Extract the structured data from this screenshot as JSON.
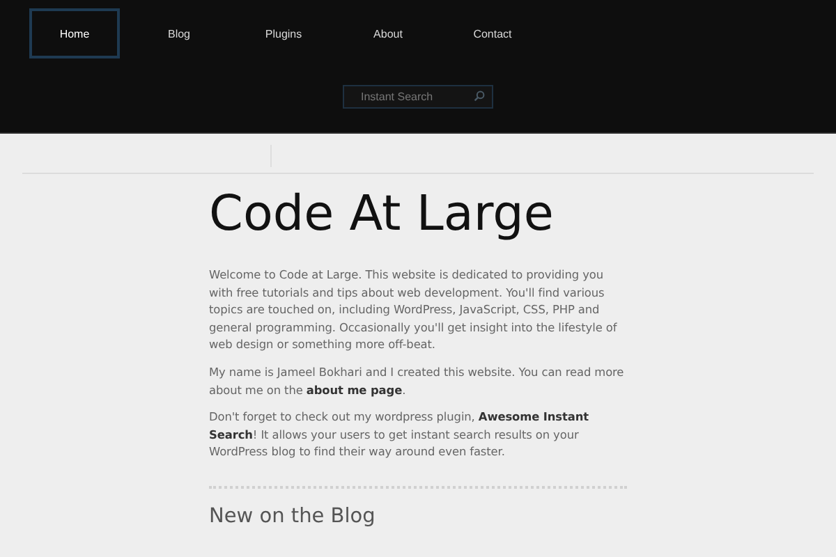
{
  "nav": [
    {
      "label": "Home",
      "selected": true
    },
    {
      "label": "Blog",
      "selected": false
    },
    {
      "label": "Plugins",
      "selected": false
    },
    {
      "label": "About",
      "selected": false
    },
    {
      "label": "Contact",
      "selected": false
    }
  ],
  "search": {
    "placeholder": "Instant Search"
  },
  "title": "Code At Large",
  "paragraphs": [
    "Welcome to Code at Large. This website is dedicated to providing you with free tutorials and tips about web development. You'll find various topics are touched on, including WordPress, JavaScript, CSS, PHP and general programming. Occasionally you'll get insight into the lifestyle of web design or something more off-beat.",
    "My name is Jameel Bokhari and I created this website. You can read more about me on the **about me page**.",
    "Don't forget to check out my wordpress plugin, **Awesome Instant Search**! It allows your users to get instant search results on your WordPress blog to find their way around even faster."
  ],
  "section_heading": "New on the Blog"
}
